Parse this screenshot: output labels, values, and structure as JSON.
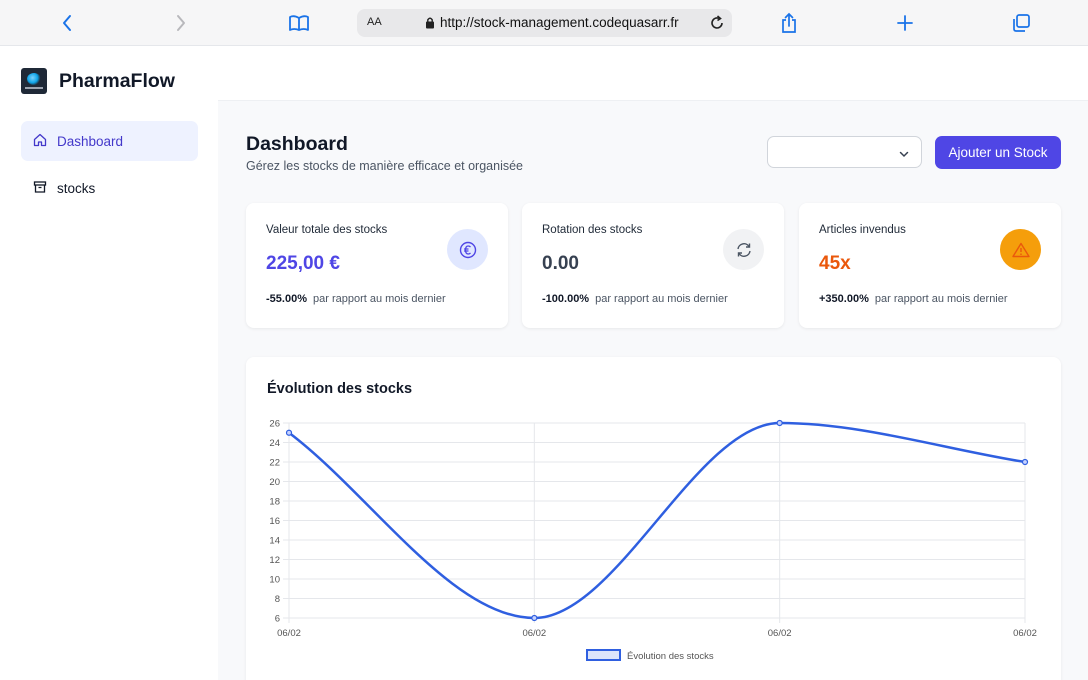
{
  "browser": {
    "aa_label": "AA",
    "url": "http://stock-management.codequasarr.fr",
    "icons": [
      "back-icon",
      "forward-icon",
      "book-icon",
      "lock-icon",
      "reload-icon",
      "share-icon",
      "plus-icon",
      "tabs-icon"
    ]
  },
  "sidebar": {
    "brand": "PharmaFlow",
    "items": [
      {
        "label": "Dashboard",
        "icon": "home-icon",
        "active": true
      },
      {
        "label": "stocks",
        "icon": "archive-icon",
        "active": false
      }
    ]
  },
  "header": {
    "title": "Dashboard",
    "subtitle": "Gérez les stocks de manière efficace et organisée",
    "select_value": "",
    "add_button": "Ajouter un Stock"
  },
  "cards": [
    {
      "title": "Valeur totale des stocks",
      "value": "225,00 €",
      "change": "-55.00%",
      "note": "par rapport au mois dernier",
      "icon": "euro-icon",
      "value_color": "#4f46e5"
    },
    {
      "title": "Rotation des stocks",
      "value": "0.00",
      "change": "-100.00%",
      "note": "par rapport au mois dernier",
      "icon": "refresh-icon",
      "value_color": "#374151"
    },
    {
      "title": "Articles invendus",
      "value": "45x",
      "change": "+350.00%",
      "note": "par rapport au mois dernier",
      "icon": "warning-icon",
      "value_color": "#ea580c"
    }
  ],
  "chart": {
    "title": "Évolution des stocks"
  },
  "chart_data": {
    "type": "line",
    "categories": [
      "06/02",
      "06/02",
      "06/02",
      "06/02"
    ],
    "series": [
      {
        "name": "Évolution des stocks",
        "values": [
          25,
          6,
          26,
          22
        ],
        "color": "#2f5fe0"
      }
    ],
    "ylim": [
      6,
      26
    ],
    "yticks": [
      6,
      8,
      10,
      12,
      14,
      16,
      18,
      20,
      22,
      24,
      26
    ],
    "grid": true,
    "legend": "bottom"
  }
}
